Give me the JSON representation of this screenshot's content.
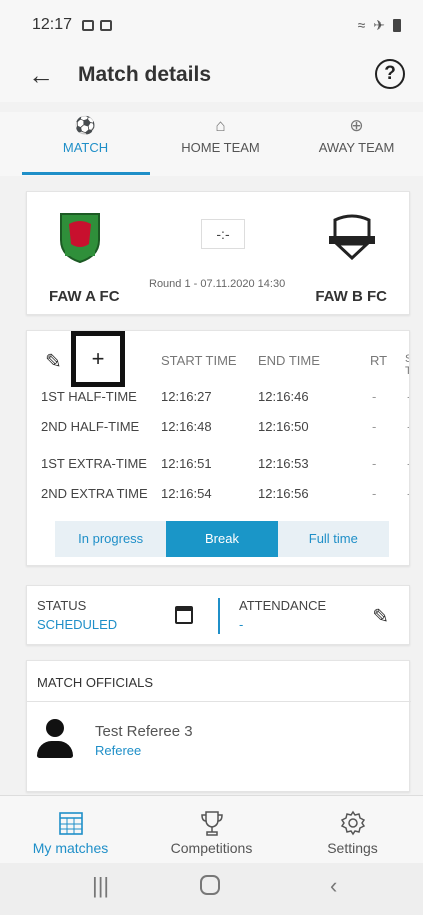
{
  "status_bar": {
    "time": "12:17"
  },
  "app_bar": {
    "title": "Match details",
    "help_label": "?"
  },
  "tabs": [
    {
      "label": "MATCH",
      "icon": "ball-icon"
    },
    {
      "label": "HOME TEAM",
      "icon": "home-icon"
    },
    {
      "label": "AWAY TEAM",
      "icon": "plane-icon"
    }
  ],
  "match": {
    "home_team": "FAW A FC",
    "away_team": "FAW B FC",
    "score": "-:-",
    "round_info": "Round 1 - 07.11.2020 14:30"
  },
  "periods": {
    "add_label": "+",
    "headers": {
      "start": "START TIME",
      "end": "END TIME",
      "rt": "RT",
      "extra": "S T"
    },
    "rows": [
      {
        "name": "1ST HALF-TIME",
        "start": "12:16:27",
        "end": "12:16:46",
        "rt": "-",
        "extra": "-"
      },
      {
        "name": "2ND HALF-TIME",
        "start": "12:16:48",
        "end": "12:16:50",
        "rt": "-",
        "extra": "-"
      },
      {
        "name": "1ST EXTRA-TIME",
        "start": "12:16:51",
        "end": "12:16:53",
        "rt": "-",
        "extra": "-"
      },
      {
        "name": "2ND EXTRA TIME",
        "start": "12:16:54",
        "end": "12:16:56",
        "rt": "-",
        "extra": "-"
      }
    ],
    "states": [
      "In progress",
      "Break",
      "Full time"
    ],
    "active_state": "Break"
  },
  "status_card": {
    "status_label": "STATUS",
    "status_value": "SCHEDULED",
    "attendance_label": "ATTENDANCE",
    "attendance_value": "-"
  },
  "officials": {
    "title": "MATCH OFFICIALS",
    "items": [
      {
        "name": "Test Referee 3",
        "role": "Referee"
      }
    ]
  },
  "bottom_nav": [
    {
      "label": "My matches",
      "icon": "calendar-grid-icon",
      "active": true
    },
    {
      "label": "Competitions",
      "icon": "trophy-icon",
      "active": false
    },
    {
      "label": "Settings",
      "icon": "gear-icon",
      "active": false
    }
  ],
  "colors": {
    "accent": "#1f8fc8"
  }
}
